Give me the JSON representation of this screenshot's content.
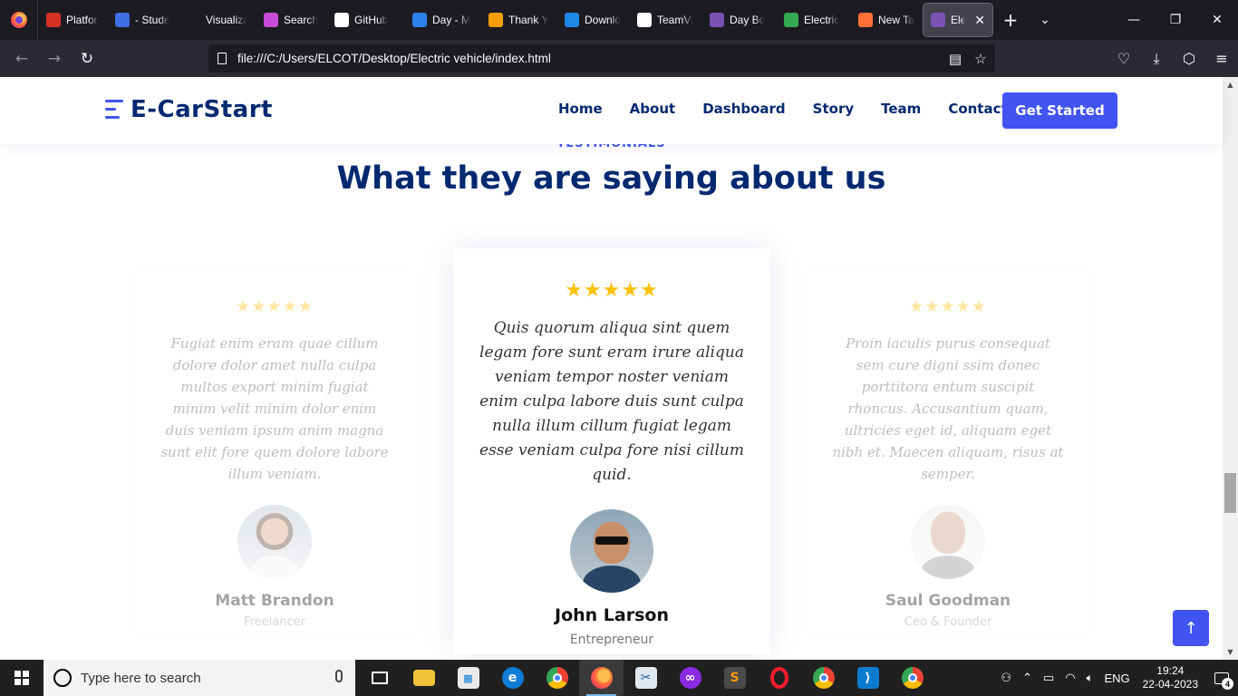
{
  "browser": {
    "tabs": [
      {
        "label": "",
        "favicon": "firefox-icon",
        "color": "#ff7139"
      },
      {
        "label": "Platform",
        "favicon": "gmail-icon",
        "color": "#d93025"
      },
      {
        "label": "- Student",
        "favicon": "course-icon",
        "color": "#3d6fe0"
      },
      {
        "label": "Visualization",
        "favicon": "blank-icon",
        "color": "#1c1b22"
      },
      {
        "label": "Search",
        "favicon": "search-sparkle-icon",
        "color": "#c64bd6"
      },
      {
        "label": "GitHub",
        "favicon": "github-icon",
        "color": "#ffffff"
      },
      {
        "label": "Day - M",
        "favicon": "day-icon",
        "color": "#2f80ed"
      },
      {
        "label": "Thank Y",
        "favicon": "thank-icon",
        "color": "#f59e0b"
      },
      {
        "label": "Downlo",
        "favicon": "vscode-icon",
        "color": "#1e88e5"
      },
      {
        "label": "TeamVi",
        "favicon": "teamviewer-icon",
        "color": "#ffffff"
      },
      {
        "label": "Day Bo",
        "favicon": "bootstrap-icon",
        "color": "#7952b3"
      },
      {
        "label": "Electric",
        "favicon": "drive-icon",
        "color": "#34a853"
      },
      {
        "label": "New Ta",
        "favicon": "firefox-icon",
        "color": "#ff7139"
      },
      {
        "label": "Elect",
        "favicon": "bootstrap-icon",
        "color": "#7952b3",
        "active": true
      }
    ],
    "url": "file:///C:/Users/ELCOT/Desktop/Electric vehicle/index.html"
  },
  "site": {
    "brand": "E-CarStart",
    "nav": [
      "Home",
      "About",
      "Dashboard",
      "Story",
      "Team",
      "Contact"
    ],
    "cta": "Get Started",
    "accent": "#4154f1",
    "navy": "#012970"
  },
  "section": {
    "kicker": "TESTIMONIALS",
    "title": "What they are saying about us"
  },
  "testimonials": [
    {
      "stars": "★★★★★",
      "quote": "Fugiat enim eram quae cillum dolore dolor amet nulla culpa multos export minim fugiat minim velit minim dolor enim duis veniam ipsum anim magna sunt elit fore quem dolore labore illum veniam.",
      "name": "Matt Brandon",
      "role": "Freelancer"
    },
    {
      "stars": "★★★★★",
      "quote": "Quis quorum aliqua sint quem legam fore sunt eram irure aliqua veniam tempor noster veniam enim culpa labore duis sunt culpa nulla illum cillum fugiat legam esse veniam culpa fore nisi cillum quid.",
      "name": "John Larson",
      "role": "Entrepreneur"
    },
    {
      "stars": "★★★★★",
      "quote": "Proin iaculis purus consequat sem cure digni ssim donec porttitora entum suscipit rhoncus. Accusantium quam, ultricies eget id, aliquam eget nibh et. Maecen aliquam, risus at semper.",
      "name": "Saul Goodman",
      "role": "Ceo & Founder"
    }
  ],
  "taskbar": {
    "search_placeholder": "Type here to search",
    "language": "ENG",
    "time": "19:24",
    "date": "22-04-2023",
    "notifications": "4"
  }
}
